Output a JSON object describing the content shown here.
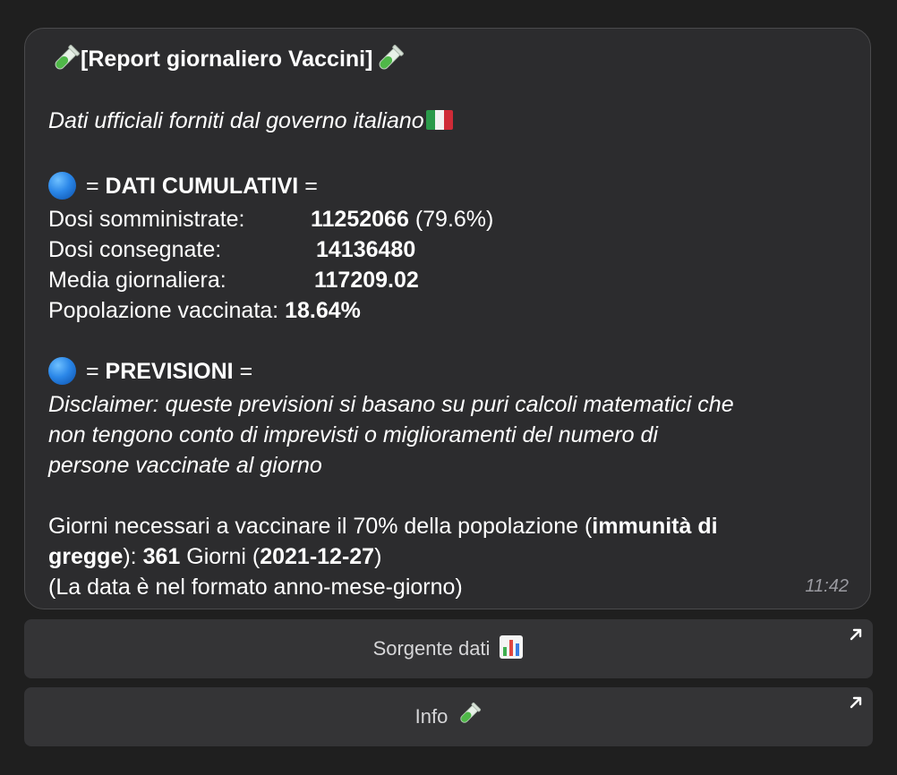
{
  "message": {
    "title": "[Report giornaliero Vaccini]",
    "subtitle": "Dati ufficiali forniti dal governo italiano",
    "cumulative": {
      "eq_left": "=",
      "heading": "DATI CUMULATIVI",
      "eq_right": "=",
      "rows": [
        {
          "label": "Dosi somministrate:",
          "value": "11252066",
          "extra": "(79.6%)"
        },
        {
          "label": "Dosi consegnate:",
          "value": "14136480"
        },
        {
          "label": "Media giornaliera:",
          "value": "117209.02"
        },
        {
          "label": "Popolazione vaccinata:",
          "value": "18.64%"
        }
      ]
    },
    "forecast": {
      "eq_left": "=",
      "heading": "PREVISIONI",
      "eq_right": "=",
      "disclaimer_lines": [
        "Disclaimer: queste previsioni si basano su puri calcoli matematici che",
        "non tengono conto di imprevisti o miglioramenti del numero di",
        "persone vaccinate al giorno"
      ],
      "days_text_1": "Giorni necessari a vaccinare il 70% della popolazione (",
      "herd_bold_1": "immunità di",
      "herd_bold_2": "gregge",
      "days_text_2": "): ",
      "days_count": "361",
      "days_unit": " Giorni (",
      "date": "2021-12-27",
      "close_paren": ")",
      "format_note": "(La data è nel formato anno-mese-giorno)"
    },
    "time": "11:42"
  },
  "buttons": [
    {
      "label": "Sorgente dati",
      "icon": "bar-chart-icon"
    },
    {
      "label": "Info",
      "icon": "test-tube-icon"
    }
  ],
  "colors": {
    "background": "#1f1f1f",
    "bubble": "#2c2c2e",
    "button": "#343436",
    "timestamp": "#9a9aa0",
    "dot_blue": "#2b87e8"
  }
}
